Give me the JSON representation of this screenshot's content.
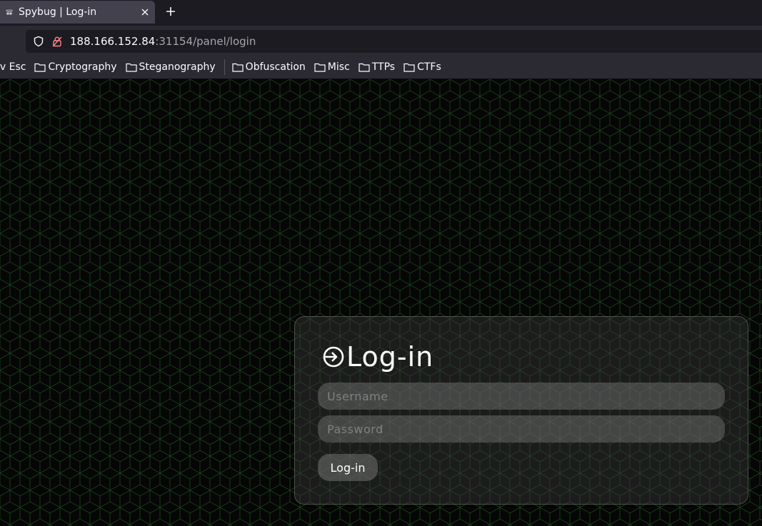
{
  "browser": {
    "tab_title": "Spybug | Log-in",
    "url_host": "188.166.152.84",
    "url_path": ":31154/panel/login",
    "bookmarks": [
      {
        "label": "iv Esc"
      },
      {
        "label": "Cryptography"
      },
      {
        "label": "Steganography"
      },
      {
        "label": "Obfuscation"
      },
      {
        "label": "Misc"
      },
      {
        "label": "TTPs"
      },
      {
        "label": "CTFs"
      }
    ]
  },
  "login": {
    "heading": "Log-in",
    "username_placeholder": "Username",
    "password_placeholder": "Password",
    "submit_label": "Log-in"
  },
  "colors": {
    "background": "#050605",
    "pattern": "#1f4d1f",
    "card": "#3c3c3c"
  },
  "icons": {
    "favicon": "spy-icon",
    "login_icon": "login-arrow-icon"
  }
}
